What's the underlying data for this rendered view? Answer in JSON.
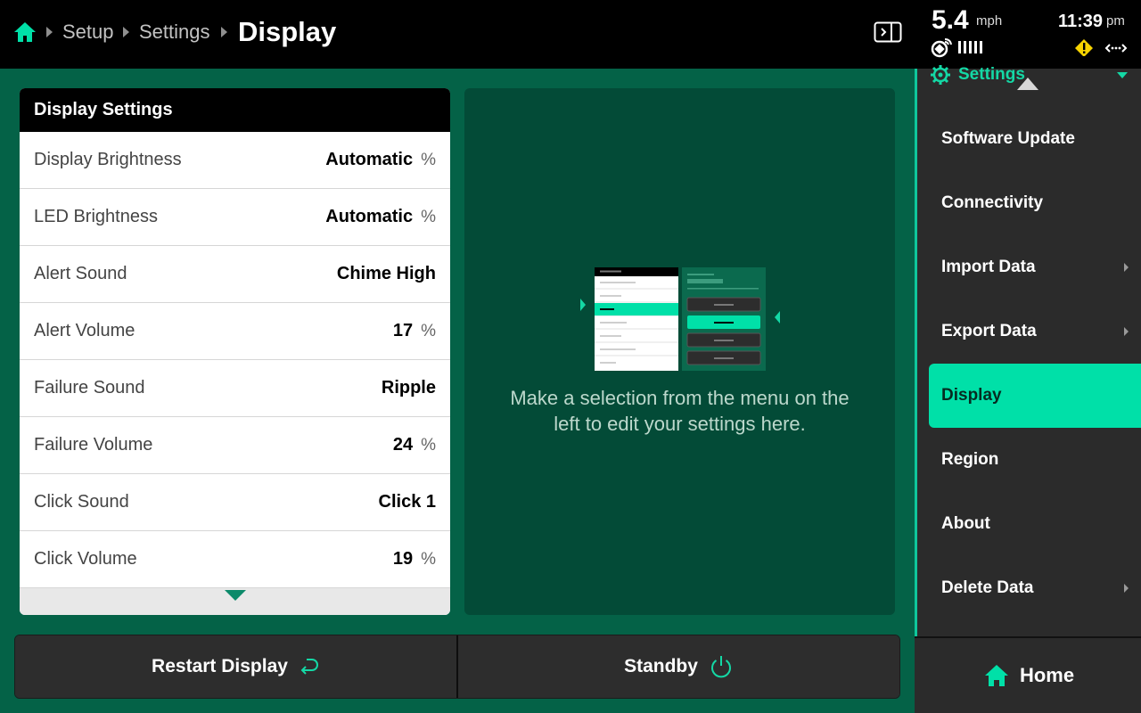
{
  "topbar": {
    "breadcrumb": [
      "Setup",
      "Settings"
    ],
    "current": "Display",
    "speed": {
      "value": "5.4",
      "unit": "mph"
    },
    "clock": {
      "time": "11:39",
      "ampm": "pm"
    },
    "accent": "#00e0a8"
  },
  "settings_card": {
    "title": "Display Settings",
    "rows": [
      {
        "label": "Display Brightness",
        "value": "Automatic",
        "unit": "%"
      },
      {
        "label": "LED Brightness",
        "value": "Automatic",
        "unit": "%"
      },
      {
        "label": "Alert Sound",
        "value": "Chime High",
        "unit": ""
      },
      {
        "label": "Alert Volume",
        "value": "17",
        "unit": "%"
      },
      {
        "label": "Failure Sound",
        "value": "Ripple",
        "unit": ""
      },
      {
        "label": "Failure Volume",
        "value": "24",
        "unit": "%"
      },
      {
        "label": "Click Sound",
        "value": "Click 1",
        "unit": ""
      },
      {
        "label": "Click Volume",
        "value": "19",
        "unit": "%"
      }
    ]
  },
  "preview": {
    "message": "Make a selection from the menu on the left to edit your settings here."
  },
  "actions": {
    "restart_label": "Restart Display",
    "standby_label": "Standby"
  },
  "side_menu": {
    "title": "Settings",
    "items": [
      {
        "label": "Software Update",
        "submenu": false,
        "active": false
      },
      {
        "label": "Connectivity",
        "submenu": false,
        "active": false
      },
      {
        "label": "Import Data",
        "submenu": true,
        "active": false
      },
      {
        "label": "Export Data",
        "submenu": true,
        "active": false
      },
      {
        "label": "Display",
        "submenu": false,
        "active": true
      },
      {
        "label": "Region",
        "submenu": false,
        "active": false
      },
      {
        "label": "About",
        "submenu": false,
        "active": false
      },
      {
        "label": "Delete Data",
        "submenu": true,
        "active": false
      }
    ],
    "home_label": "Home"
  }
}
